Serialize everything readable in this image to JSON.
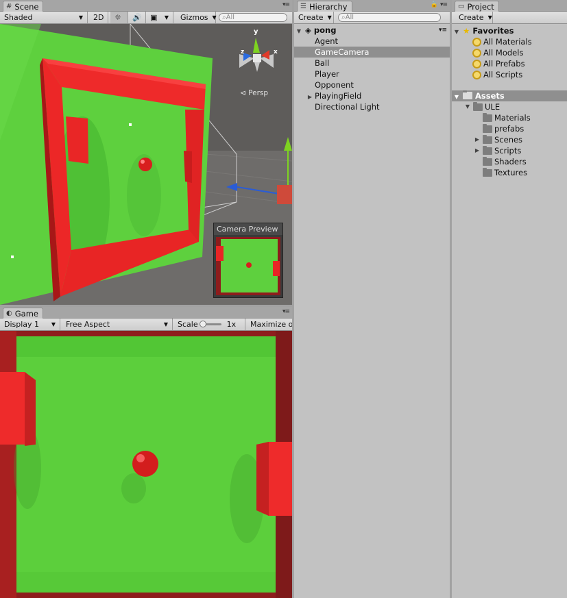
{
  "scene": {
    "tab": "Scene",
    "shading": "Shaded",
    "mode_2d": "2D",
    "gizmos": "Gizmos",
    "search_placeholder": "All",
    "persp": "Persp",
    "axis_y": "y",
    "axis_x": "x",
    "axis_z": "z",
    "camera_preview": "Camera Preview"
  },
  "game": {
    "tab": "Game",
    "display": "Display 1",
    "aspect": "Free Aspect",
    "scale_label": "Scale",
    "scale_value": "1x",
    "maximize": "Maximize on Play"
  },
  "hierarchy": {
    "tab": "Hierarchy",
    "create": "Create",
    "search_placeholder": "All",
    "scene_name": "pong",
    "items": [
      {
        "label": "Agent",
        "selected": false,
        "expandable": false
      },
      {
        "label": "GameCamera",
        "selected": true,
        "expandable": false
      },
      {
        "label": "Ball",
        "selected": false,
        "expandable": false
      },
      {
        "label": "Player",
        "selected": false,
        "expandable": false
      },
      {
        "label": "Opponent",
        "selected": false,
        "expandable": false
      },
      {
        "label": "PlayingField",
        "selected": false,
        "expandable": true
      },
      {
        "label": "Directional Light",
        "selected": false,
        "expandable": false
      }
    ]
  },
  "project": {
    "tab": "Project",
    "create": "Create",
    "favorites_label": "Favorites",
    "favorites": [
      "All Materials",
      "All Models",
      "All Prefabs",
      "All Scripts"
    ],
    "assets_label": "Assets",
    "root_folder": "ULE",
    "folders": [
      {
        "label": "Materials",
        "expandable": false
      },
      {
        "label": "prefabs",
        "expandable": false
      },
      {
        "label": "Scenes",
        "expandable": true
      },
      {
        "label": "Scripts",
        "expandable": true
      },
      {
        "label": "Shaders",
        "expandable": false
      },
      {
        "label": "Textures",
        "expandable": false
      }
    ]
  },
  "colors": {
    "field_green": "#5fd13f",
    "wall_red": "#ef2a2a",
    "selected_row": "#8f8f8f",
    "panel_bg": "#c2c2c2"
  }
}
